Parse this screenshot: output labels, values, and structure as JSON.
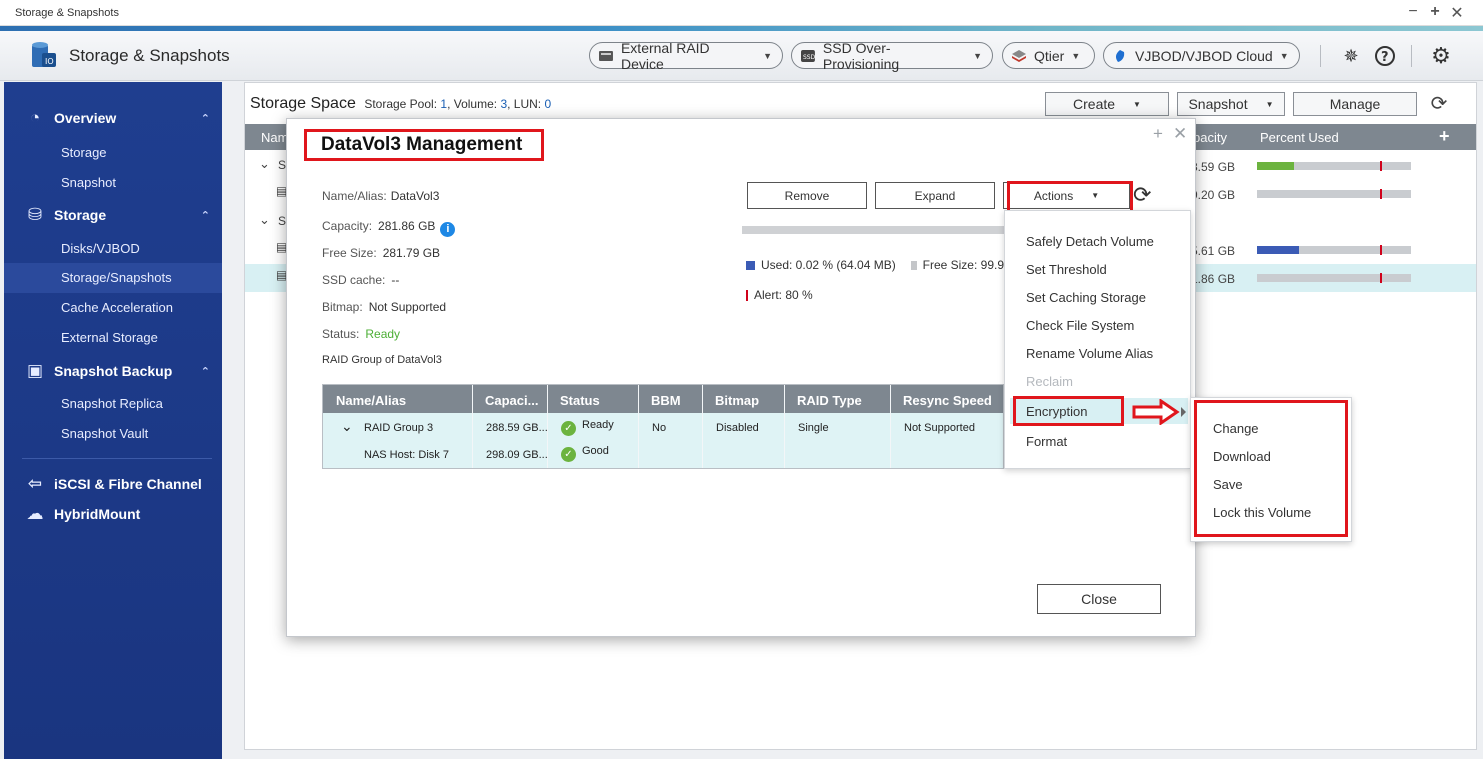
{
  "window": {
    "title": "Storage & Snapshots"
  },
  "header": {
    "app_title": "Storage & Snapshots",
    "pills": [
      {
        "label": "External RAID Device"
      },
      {
        "label": "SSD Over-Provisioning"
      },
      {
        "label": "Qtier"
      },
      {
        "label": "VJBOD/VJBOD Cloud"
      }
    ]
  },
  "sidebar": {
    "overview": {
      "label": "Overview",
      "items": [
        "Storage",
        "Snapshot"
      ]
    },
    "storage": {
      "label": "Storage",
      "items": [
        "Disks/VJBOD",
        "Storage/Snapshots",
        "Cache Acceleration",
        "External Storage"
      ]
    },
    "snapshot_backup": {
      "label": "Snapshot Backup",
      "items": [
        "Snapshot Replica",
        "Snapshot Vault"
      ]
    },
    "iscsi": {
      "label": "iSCSI & Fibre Channel"
    },
    "hybridmount": {
      "label": "HybridMount"
    }
  },
  "main": {
    "title": "Storage Space",
    "summary": {
      "pool_label": "Storage Pool:",
      "pool_count": "1",
      "volume_label": ", Volume:",
      "volume_count": "3",
      "lun_label": ", LUN:",
      "lun_count": "0"
    },
    "buttons": {
      "create": "Create",
      "snapshot": "Snapshot",
      "manage": "Manage"
    },
    "table": {
      "col_name_partial": "Nam",
      "col_capacity_partial": "pacity",
      "col_percent": "Percent Used",
      "rows": [
        {
          "name_partial": "S",
          "capacity": "8.59 GB",
          "percent_used": 0.24,
          "alert": 0.8
        },
        {
          "name_partial": "",
          "capacity": "9.20 GB",
          "percent_used": 0.0,
          "alert": 0.8
        },
        {
          "name_partial": "S",
          "capacity": "",
          "percent_used": null
        },
        {
          "name_partial": "",
          "capacity": "5.61 GB",
          "percent_used": 0.27,
          "alert": 0.8
        },
        {
          "name_partial": "",
          "capacity": "1.86 GB",
          "percent_used": 0.0,
          "alert": 0.8
        }
      ]
    }
  },
  "dialog": {
    "title": "DataVol3  Management",
    "fields": {
      "name_label": "Name/Alias:",
      "name_value": "DataVol3",
      "capacity_label": "Capacity:",
      "capacity_value": "281.86 GB",
      "free_label": "Free Size:",
      "free_value": "281.79 GB",
      "ssd_label": "SSD cache:",
      "ssd_value": "--",
      "bitmap_label": "Bitmap:",
      "bitmap_value": "Not Supported",
      "status_label": "Status:",
      "status_value": "Ready",
      "raid_group_label": "RAID Group of DataVol3"
    },
    "buttons": {
      "remove": "Remove",
      "expand": "Expand",
      "actions": "Actions",
      "close": "Close"
    },
    "usage": {
      "used_text": "Used: 0.02 % (64.04 MB)",
      "free_text_partial": "Free Size: 99.9",
      "alert_text": "Alert: 80 %"
    },
    "raid_table": {
      "headers": [
        "Name/Alias",
        "Capaci...",
        "Status",
        "BBM",
        "Bitmap",
        "RAID Type",
        "Resync Speed"
      ],
      "rows": [
        {
          "name": "RAID Group 3",
          "capacity": "288.59 GB...",
          "status": "Ready",
          "bbm": "No",
          "bitmap": "Disabled",
          "raid_type": "Single",
          "resync": "Not Supported"
        },
        {
          "name": "NAS Host: Disk 7",
          "capacity": "298.09 GB...",
          "status": "Good",
          "bbm": "",
          "bitmap": "",
          "raid_type": "",
          "resync": ""
        }
      ]
    },
    "actions_menu": {
      "items": [
        "Safely Detach Volume",
        "Set Threshold",
        "Set Caching Storage",
        "Check File System",
        "Rename Volume Alias",
        "Reclaim",
        "Encryption",
        "Format"
      ],
      "disabled": [
        "Reclaim"
      ]
    },
    "encryption_submenu": {
      "items": [
        "Change",
        "Download",
        "Save",
        "Lock this Volume"
      ]
    }
  },
  "colors": {
    "accent_red": "#e0161c",
    "sidebar_blue": "#1f3e8f",
    "used_blue": "#3b5bb5",
    "used_green": "#6cb33f",
    "alert_red": "#d0021b"
  }
}
